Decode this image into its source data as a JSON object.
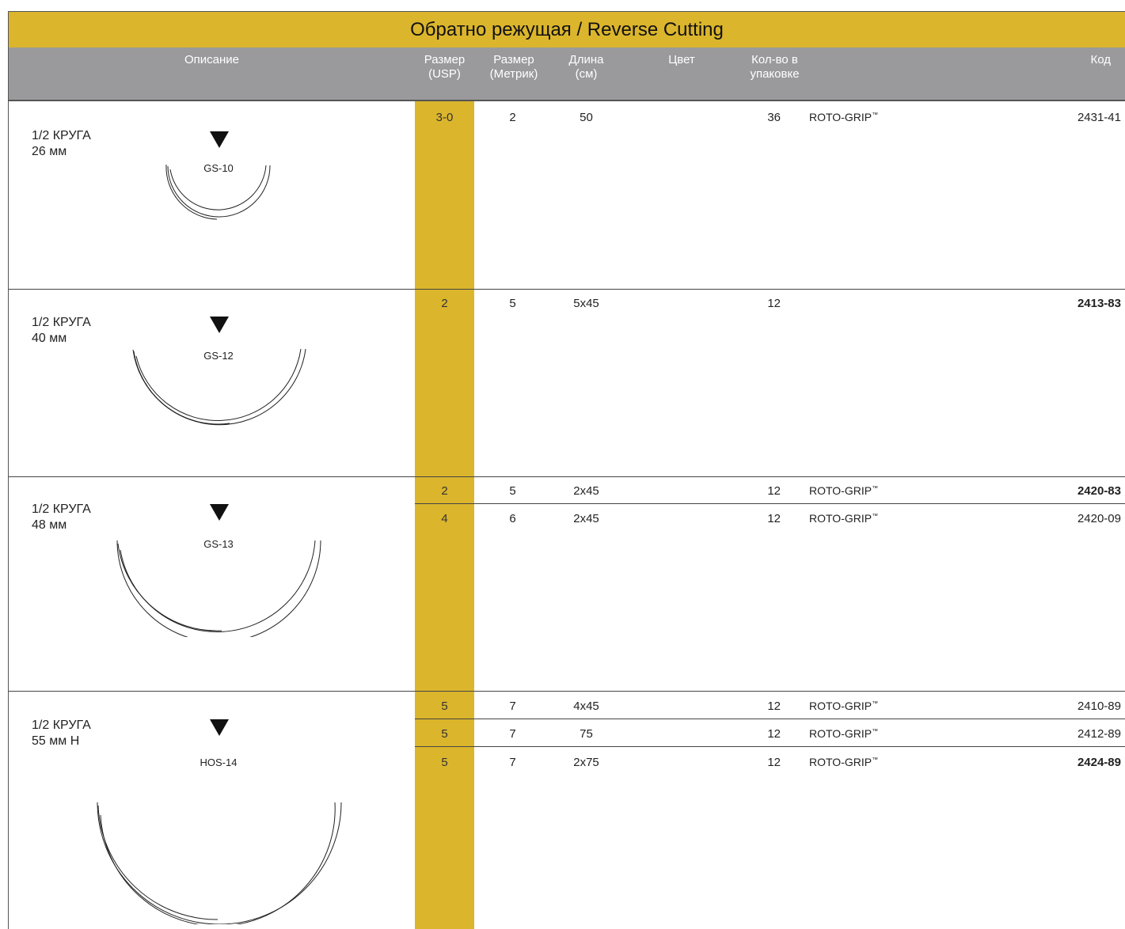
{
  "title": "Обратно режущая / Reverse Cutting",
  "header": {
    "description": "Описание",
    "size_usp": "Размер\n(USP)",
    "size_metric": "Размер\n(Метрик)",
    "length": "Длина\n(см)",
    "color": "Цвет",
    "qty": "Кол-во в\nупаковке",
    "code": "Код"
  },
  "groups": [
    {
      "desc_line1": "1/2 КРУГА",
      "desc_line2": "26 мм",
      "needle": "GS-10",
      "rows": [
        {
          "usp": "3-0",
          "metric": "2",
          "length": "50",
          "qty": "36",
          "note": "ROTO-GRIP",
          "note_sup": "™",
          "code": "2431-41",
          "code_bold": false
        }
      ]
    },
    {
      "desc_line1": "1/2 КРУГА",
      "desc_line2": "40 мм",
      "needle": "GS-12",
      "rows": [
        {
          "usp": "2",
          "metric": "5",
          "length": "5x45",
          "qty": "12",
          "note": "",
          "note_sup": "",
          "code": "2413-83",
          "code_bold": true
        }
      ]
    },
    {
      "desc_line1": "1/2 КРУГА",
      "desc_line2": "48 мм",
      "needle": "GS-13",
      "rows": [
        {
          "usp": "2",
          "metric": "5",
          "length": "2x45",
          "qty": "12",
          "note": "ROTO-GRIP",
          "note_sup": "™",
          "code": "2420-83",
          "code_bold": true
        },
        {
          "usp": "4",
          "metric": "6",
          "length": "2x45",
          "qty": "12",
          "note": "ROTO-GRIP",
          "note_sup": "™",
          "code": "2420-09",
          "code_bold": false
        }
      ]
    },
    {
      "desc_line1": "1/2 КРУГА",
      "desc_line2": "55 мм Н",
      "needle": "HOS-14",
      "rows": [
        {
          "usp": "5",
          "metric": "7",
          "length": "4x45",
          "qty": "12",
          "note": "ROTO-GRIP",
          "note_sup": "™",
          "code": "2410-89",
          "code_bold": false
        },
        {
          "usp": "5",
          "metric": "7",
          "length": "75",
          "qty": "12",
          "note": "ROTO-GRIP",
          "note_sup": "™",
          "code": "2412-89",
          "code_bold": false
        },
        {
          "usp": "5",
          "metric": "7",
          "length": "2x75",
          "qty": "12",
          "note": "ROTO-GRIP",
          "note_sup": "™",
          "code": "2424-89",
          "code_bold": true
        }
      ]
    }
  ],
  "colors": {
    "gold": "#dbb52c",
    "header_gray": "#9a9a9c"
  }
}
